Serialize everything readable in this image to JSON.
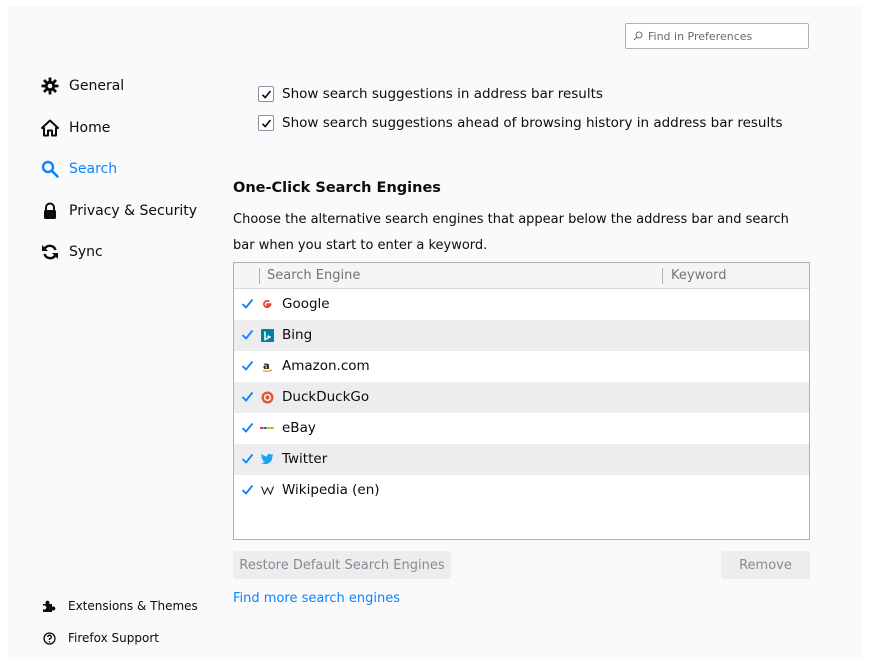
{
  "find": {
    "placeholder": "Find in Preferences"
  },
  "sidebar": {
    "categories": [
      {
        "label": "General",
        "icon": "gear-icon"
      },
      {
        "label": "Home",
        "icon": "home-icon"
      },
      {
        "label": "Search",
        "icon": "search-icon",
        "selected": true
      },
      {
        "label": "Privacy & Security",
        "icon": "lock-icon"
      },
      {
        "label": "Sync",
        "icon": "sync-icon"
      }
    ],
    "footer": [
      {
        "label": "Extensions & Themes",
        "icon": "puzzle-icon"
      },
      {
        "label": "Firefox Support",
        "icon": "help-icon"
      }
    ]
  },
  "suggestions": {
    "items": [
      {
        "label": "Show search suggestions in address bar results",
        "checked": true
      },
      {
        "label": "Show search suggestions ahead of browsing history in address bar results",
        "checked": true
      }
    ]
  },
  "engines": {
    "heading": "One-Click Search Engines",
    "description": "Choose the alternative search engines that appear below the address bar and search bar when you start to enter a keyword.",
    "columns": {
      "engine": "Search Engine",
      "keyword": "Keyword"
    },
    "rows": [
      {
        "name": "Google",
        "logo": "google-logo-icon",
        "enabled": true
      },
      {
        "name": "Bing",
        "logo": "bing-logo-icon",
        "enabled": true
      },
      {
        "name": "Amazon.com",
        "logo": "amazon-logo-icon",
        "enabled": true
      },
      {
        "name": "DuckDuckGo",
        "logo": "duckduckgo-logo-icon",
        "enabled": true
      },
      {
        "name": "eBay",
        "logo": "ebay-logo-icon",
        "enabled": true
      },
      {
        "name": "Twitter",
        "logo": "twitter-logo-icon",
        "enabled": true
      },
      {
        "name": "Wikipedia (en)",
        "logo": "wikipedia-logo-icon",
        "enabled": true
      }
    ],
    "restore_label": "Restore Default Search Engines",
    "remove_label": "Remove",
    "find_more_label": "Find more search engines"
  },
  "colors": {
    "accent": "#0a84ff",
    "text": "#0c0c0d",
    "row_alt": "#ededf0"
  }
}
